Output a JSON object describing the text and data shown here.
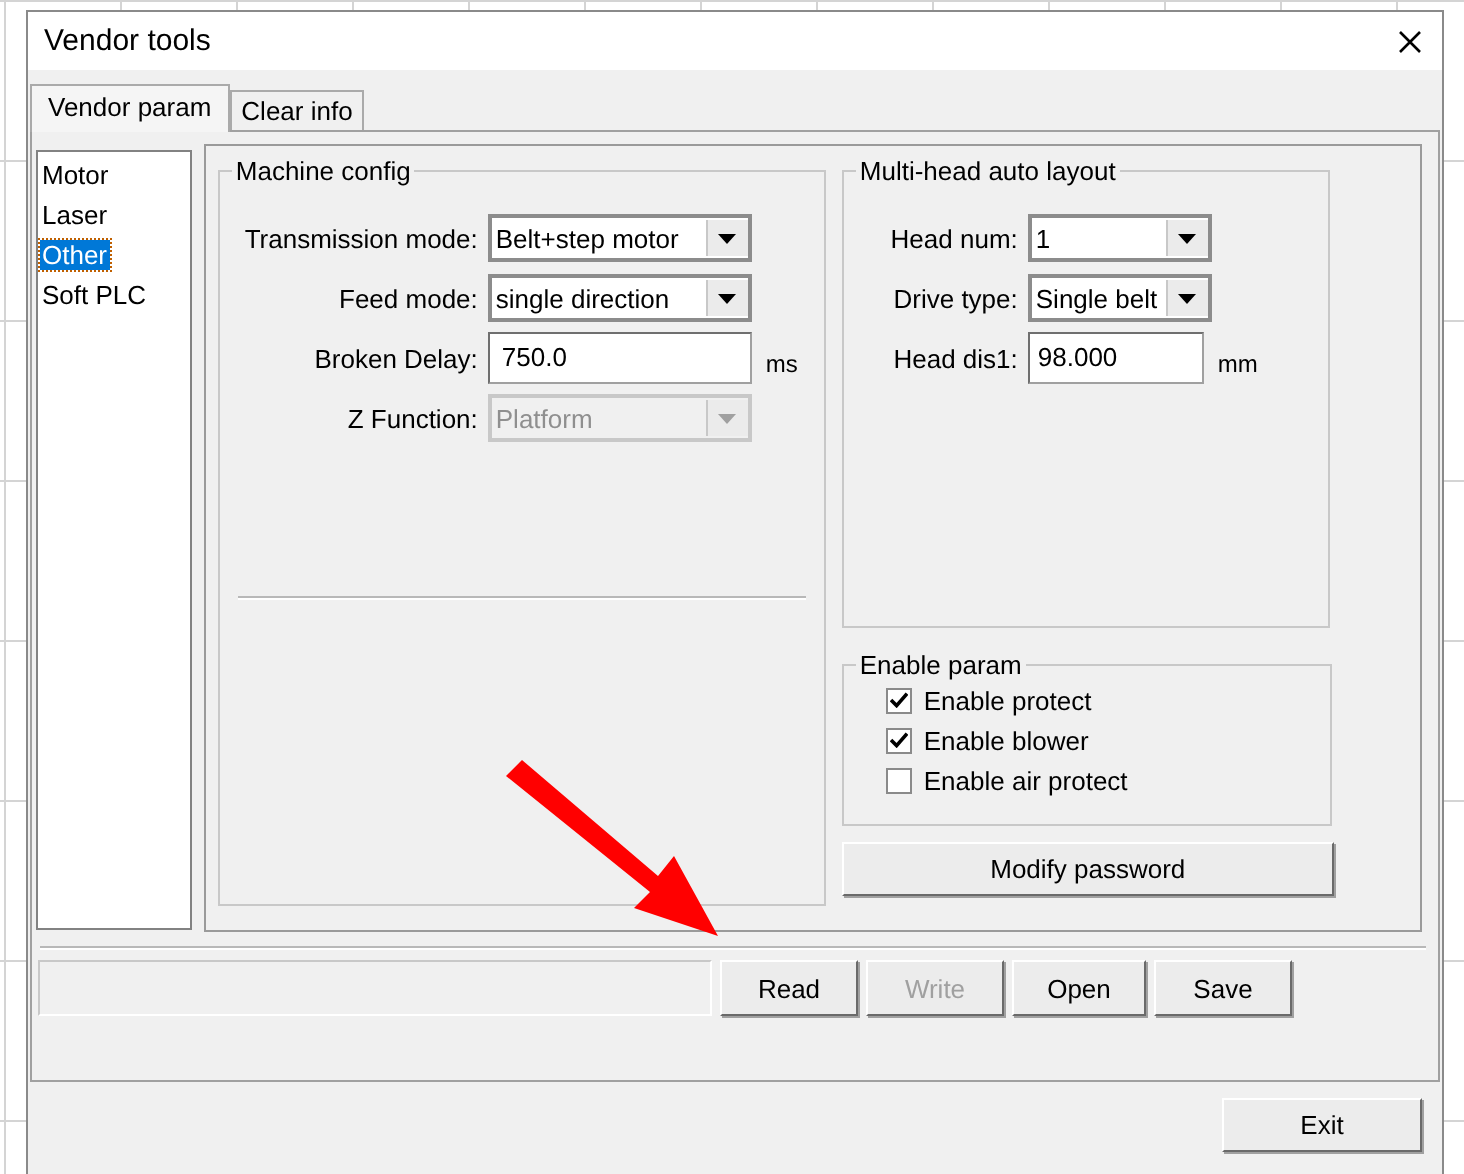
{
  "window": {
    "title": "Vendor tools"
  },
  "tabs": [
    {
      "label": "Vendor param",
      "selected": true
    },
    {
      "label": "Clear info",
      "selected": false
    }
  ],
  "categories": [
    {
      "label": "Motor",
      "selected": false
    },
    {
      "label": "Laser",
      "selected": false
    },
    {
      "label": "Other",
      "selected": true
    },
    {
      "label": "Soft PLC",
      "selected": false
    }
  ],
  "machine_config": {
    "title": "Machine config",
    "fields": [
      {
        "kind": "dropdown",
        "label": "Transmission mode:",
        "value": "Belt+step motor",
        "disabled": false
      },
      {
        "kind": "dropdown",
        "label": "Feed mode:",
        "value": "single direction",
        "disabled": false
      },
      {
        "kind": "text",
        "label": "Broken Delay:",
        "value": "750.0",
        "unit": "ms",
        "disabled": false
      },
      {
        "kind": "dropdown",
        "label": "Z Function:",
        "value": "Platform",
        "disabled": true
      }
    ]
  },
  "multi_head": {
    "title": "Multi-head auto layout",
    "fields": [
      {
        "kind": "dropdown",
        "label": "Head num:",
        "value": "1",
        "disabled": false
      },
      {
        "kind": "dropdown",
        "label": "Drive type:",
        "value": "Single belt",
        "disabled": false
      },
      {
        "kind": "text",
        "label": "Head dis1:",
        "value": "98.000",
        "unit": "mm",
        "disabled": false
      }
    ]
  },
  "enable_param": {
    "title": "Enable param",
    "options": [
      {
        "label": "Enable protect",
        "checked": true
      },
      {
        "label": "Enable blower",
        "checked": true
      },
      {
        "label": "Enable air protect",
        "checked": false
      }
    ]
  },
  "modify_password_button": "Modify password",
  "actions": [
    {
      "label": "Read",
      "disabled": false
    },
    {
      "label": "Write",
      "disabled": true
    },
    {
      "label": "Open",
      "disabled": false
    },
    {
      "label": "Save",
      "disabled": false
    }
  ],
  "exit_button": "Exit"
}
